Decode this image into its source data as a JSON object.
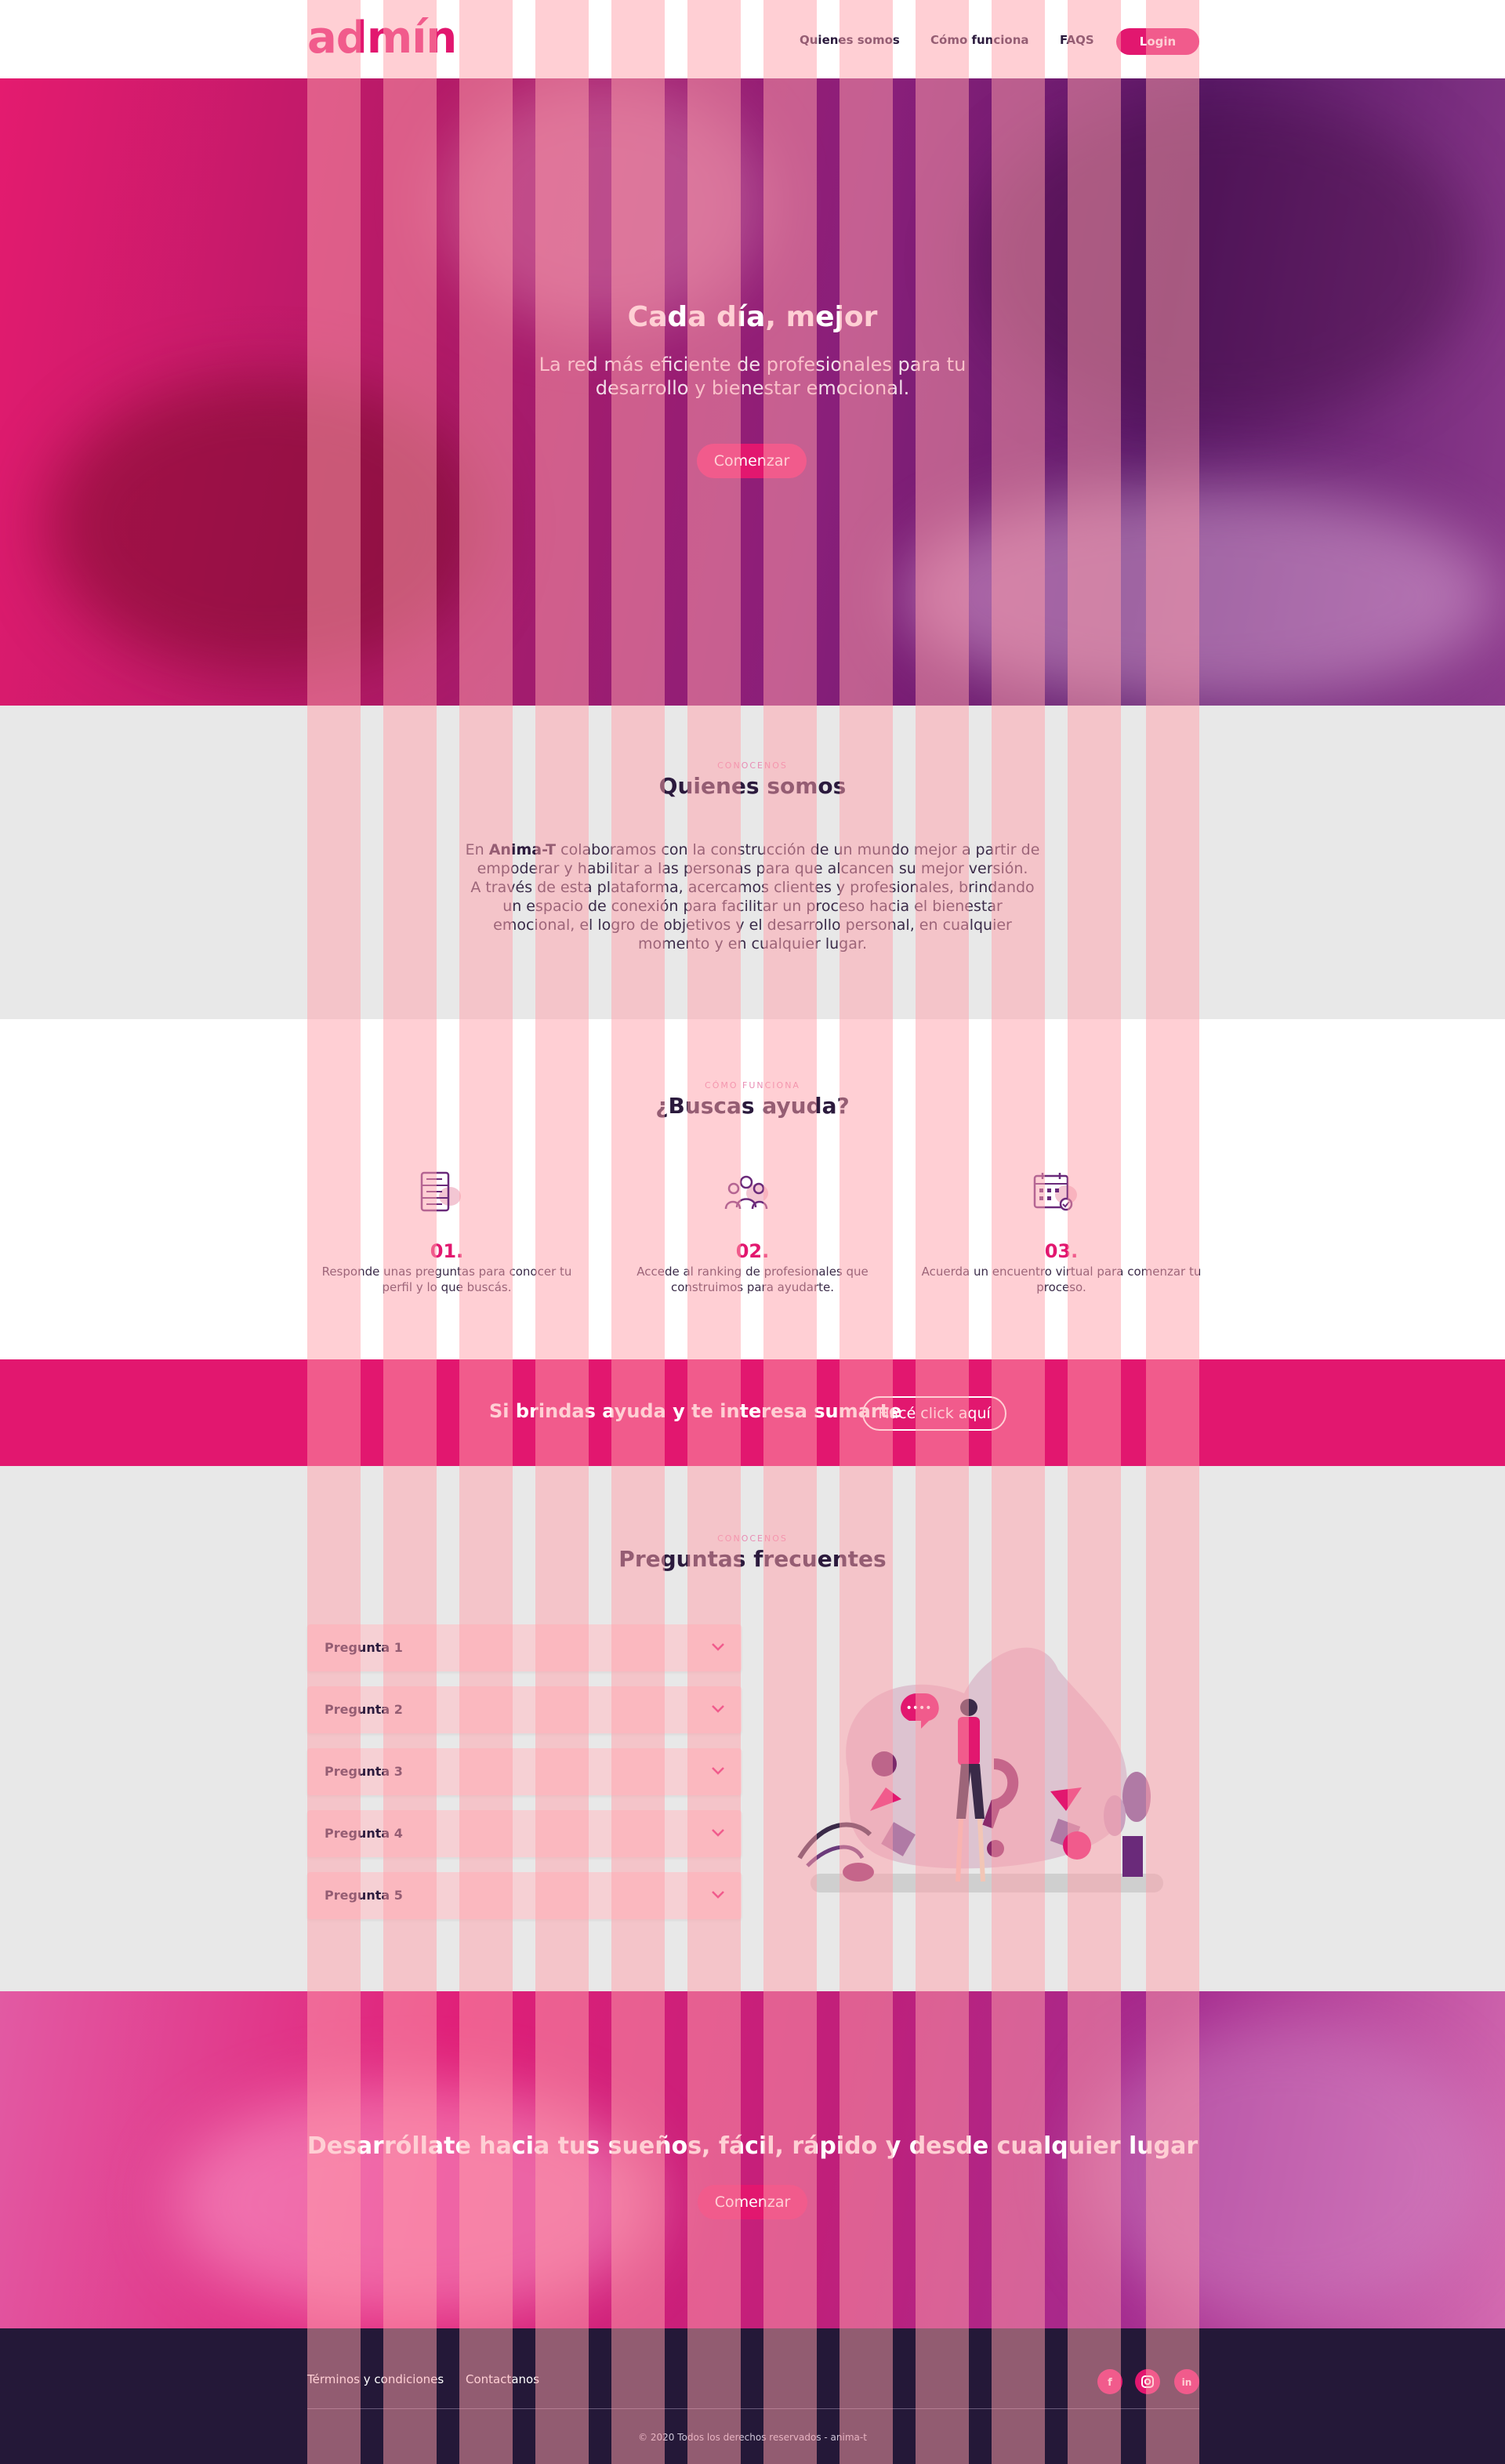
{
  "navbar": {
    "logo": "admín",
    "links": [
      "Quienes somos",
      "Cómo funciona",
      "FAQS"
    ],
    "login": "Login"
  },
  "hero": {
    "title": "Cada día, mejor",
    "subtitle": "La red más eficiente de profesionales para tu desarrollo y bienestar emocional.",
    "cta": "Comenzar"
  },
  "about": {
    "eyebrow": "Conocenos",
    "title": "Quienes somos",
    "text_prefix": "En ",
    "brand": "Anima-T",
    "text_1": " colaboramos con la construcción de un mundo mejor a partir de empoderar y habilitar a las personas para que alcancen su mejor versión.",
    "text_2": "A través de esta plataforma, acercamos clientes y profesionales, brindando un espacio de conexión para facilitar un proceso hacia el bienestar emocional, el logro de objetivos y el desarrollo personal, en cualquier momento y en cualquier lugar."
  },
  "how": {
    "eyebrow": "Cómo funciona",
    "title": "¿Buscas ayuda?",
    "steps": [
      {
        "num": "01.",
        "text": "Responde unas preguntas para conocer tu perfil y lo que buscás.",
        "icon": "server-icon"
      },
      {
        "num": "02.",
        "text": "Accede al ranking de profesionales que construimos para ayudarte.",
        "icon": "people-icon"
      },
      {
        "num": "03.",
        "text": "Acuerda un encuentro virtual para comenzar tu proceso.",
        "icon": "calendar-icon"
      }
    ]
  },
  "strip": {
    "text": "Si brindas ayuda y te interesa sumarte",
    "button": "Hacé click aquí"
  },
  "faq": {
    "eyebrow": "Conocenos",
    "title": "Preguntas frecuentes",
    "items": [
      "Pregunta 1",
      "Pregunta 2",
      "Pregunta 3",
      "Pregunta 4",
      "Pregunta 5"
    ],
    "bubble": "••••"
  },
  "hero2": {
    "title": "Desarróllate hacia tus sueños, fácil, rápido y desde cualquier lugar",
    "cta": "Comenzar"
  },
  "footer": {
    "links": [
      "Términos y condiciones",
      "Contactanos"
    ],
    "social": [
      {
        "icon": "facebook-icon",
        "glyph": "f"
      },
      {
        "icon": "instagram-icon",
        "glyph": "◎"
      },
      {
        "icon": "linkedin-icon",
        "glyph": "in"
      }
    ],
    "copyright": "© 2020 Todos los derechos reservados - anima-t"
  },
  "colors": {
    "accent": "#e2176f",
    "dark": "#241838",
    "section_gray": "#e8e8e8"
  }
}
